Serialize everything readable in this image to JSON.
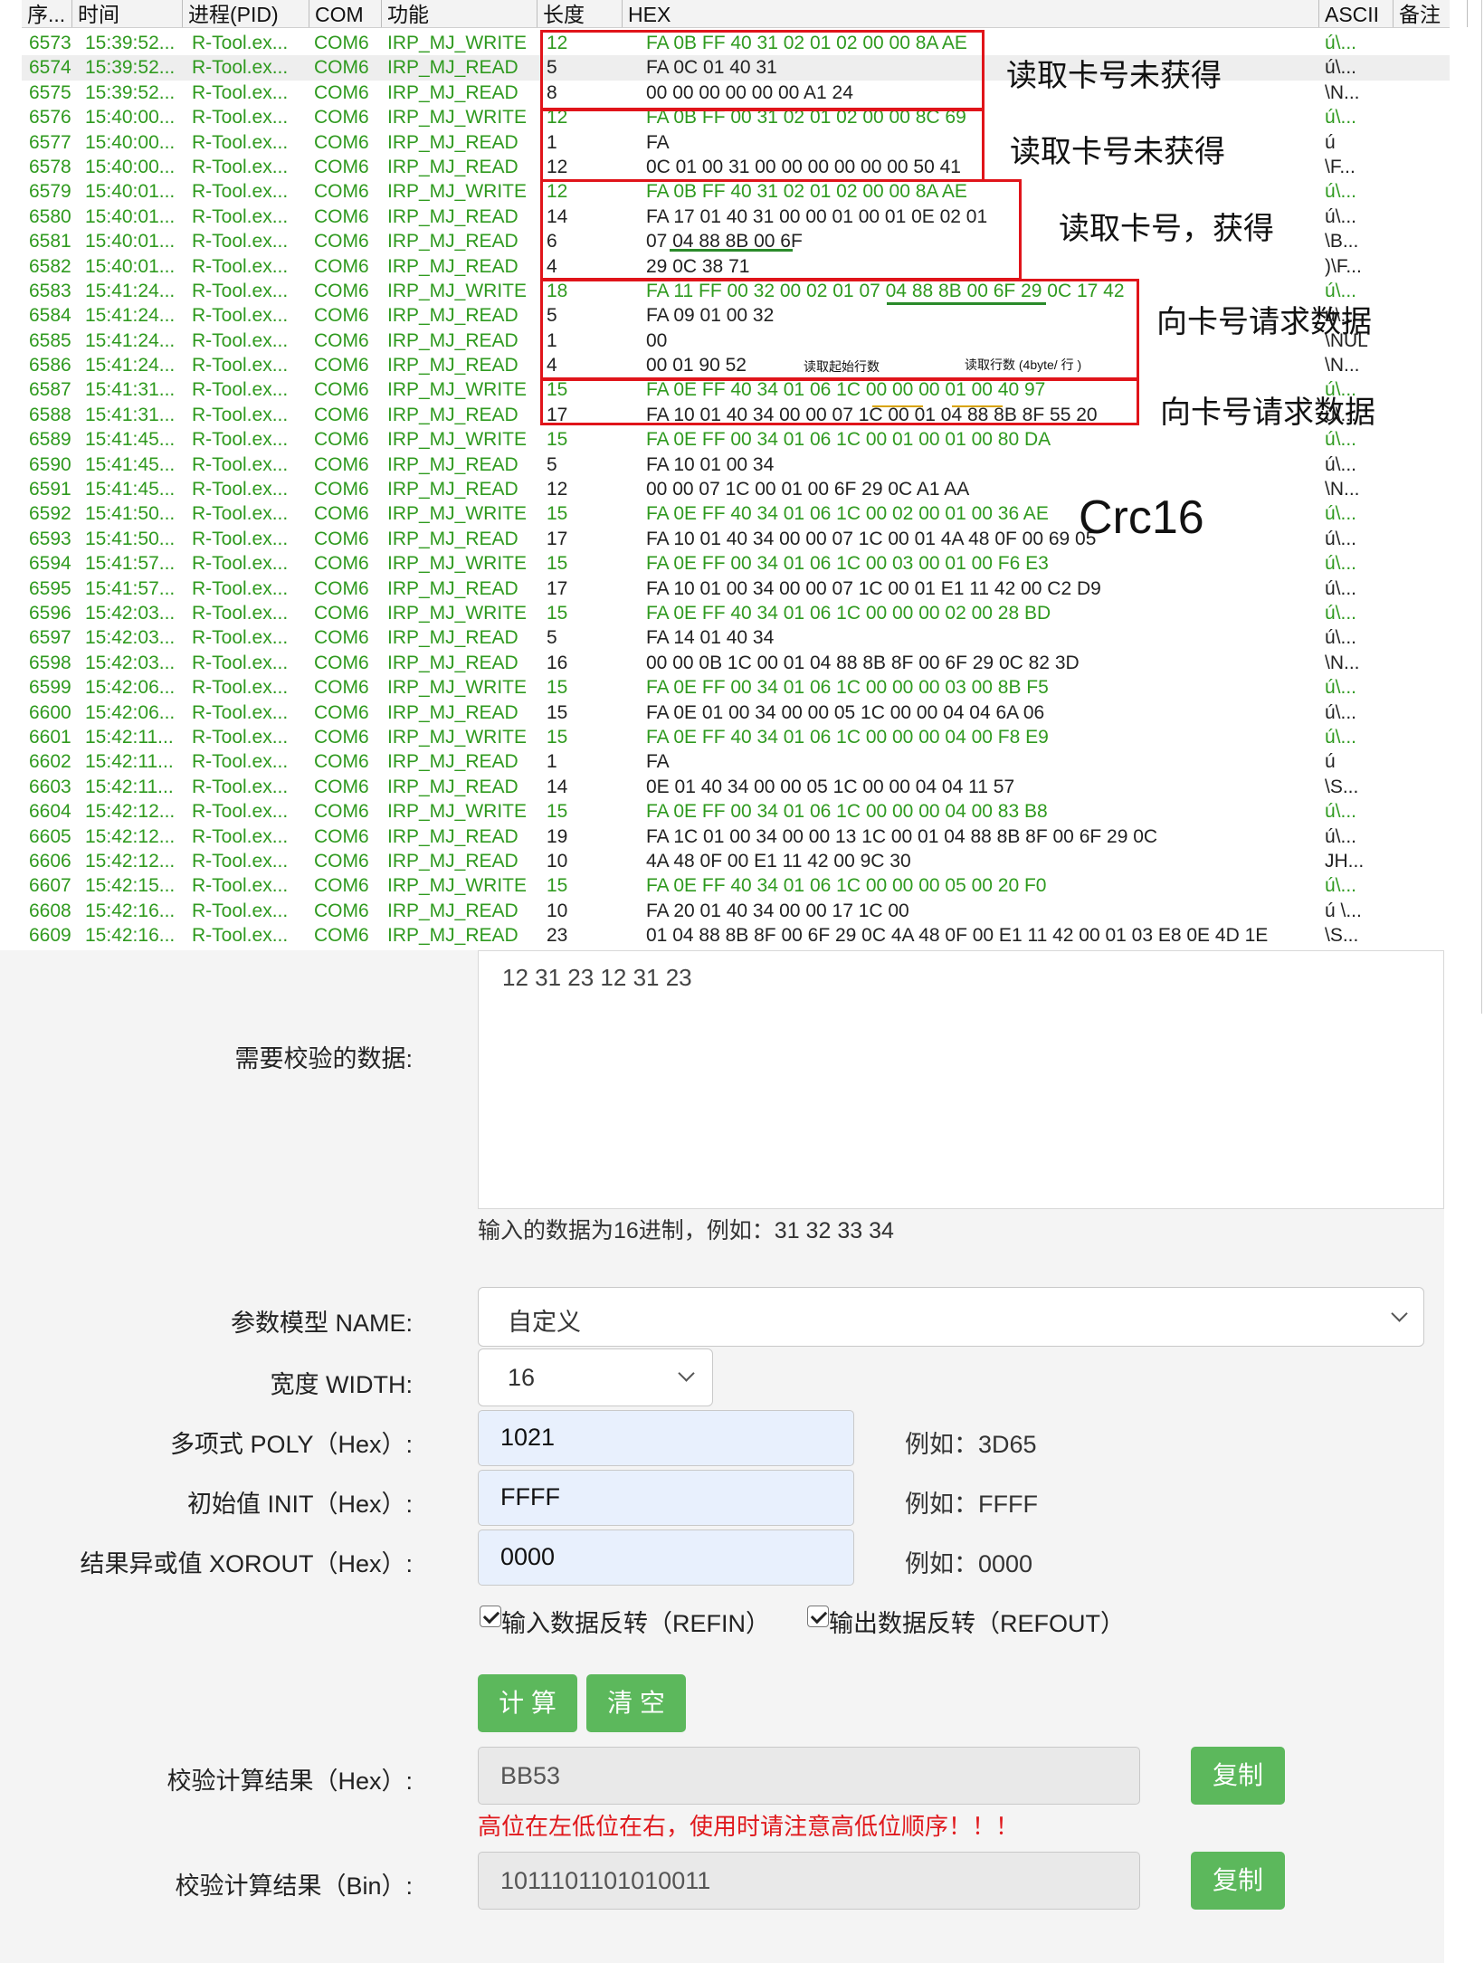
{
  "log": {
    "columns": [
      "序...",
      "时间",
      "进程(PID)",
      "COM",
      "功能",
      "长度",
      "HEX",
      "ASCII",
      "备注"
    ],
    "rows": [
      {
        "seq": "6573",
        "time": "15:39:52...",
        "proc": "R-Tool.ex...",
        "com": "COM6",
        "fn": "IRP_MJ_WRITE",
        "len": "12",
        "hex": "FA 0B FF 40 31 02 01 02 00 00 8A AE",
        "ascii": "ú\\..."
      },
      {
        "seq": "6574",
        "time": "15:39:52...",
        "proc": "R-Tool.ex...",
        "com": "COM6",
        "fn": "IRP_MJ_READ",
        "len": "5",
        "hex": "FA 0C 01 40 31",
        "ascii": "ú\\..."
      },
      {
        "seq": "6575",
        "time": "15:39:52...",
        "proc": "R-Tool.ex...",
        "com": "COM6",
        "fn": "IRP_MJ_READ",
        "len": "8",
        "hex": "00 00 00 00 00 00 A1 24",
        "ascii": "\\N..."
      },
      {
        "seq": "6576",
        "time": "15:40:00...",
        "proc": "R-Tool.ex...",
        "com": "COM6",
        "fn": "IRP_MJ_WRITE",
        "len": "12",
        "hex": "FA 0B FF 00 31 02 01 02 00 00 8C 69",
        "ascii": "ú\\..."
      },
      {
        "seq": "6577",
        "time": "15:40:00...",
        "proc": "R-Tool.ex...",
        "com": "COM6",
        "fn": "IRP_MJ_READ",
        "len": "1",
        "hex": "FA",
        "ascii": "ú"
      },
      {
        "seq": "6578",
        "time": "15:40:00...",
        "proc": "R-Tool.ex...",
        "com": "COM6",
        "fn": "IRP_MJ_READ",
        "len": "12",
        "hex": "0C 01 00 31 00 00 00 00 00 00 50 41",
        "ascii": "\\F..."
      },
      {
        "seq": "6579",
        "time": "15:40:01...",
        "proc": "R-Tool.ex...",
        "com": "COM6",
        "fn": "IRP_MJ_WRITE",
        "len": "12",
        "hex": "FA 0B FF 40 31 02 01 02 00 00 8A AE",
        "ascii": "ú\\..."
      },
      {
        "seq": "6580",
        "time": "15:40:01...",
        "proc": "R-Tool.ex...",
        "com": "COM6",
        "fn": "IRP_MJ_READ",
        "len": "14",
        "hex": "FA 17 01 40 31 00 00 01 00 01 0E 02 01",
        "ascii": "ú\\..."
      },
      {
        "seq": "6581",
        "time": "15:40:01...",
        "proc": "R-Tool.ex...",
        "com": "COM6",
        "fn": "IRP_MJ_READ",
        "len": "6",
        "hex": "07 04 88 8B 00 6F",
        "ascii": "\\B..."
      },
      {
        "seq": "6582",
        "time": "15:40:01...",
        "proc": "R-Tool.ex...",
        "com": "COM6",
        "fn": "IRP_MJ_READ",
        "len": "4",
        "hex": "29 0C 38 71",
        "ascii": ")\\F..."
      },
      {
        "seq": "6583",
        "time": "15:41:24...",
        "proc": "R-Tool.ex...",
        "com": "COM6",
        "fn": "IRP_MJ_WRITE",
        "len": "18",
        "hex": "FA 11 FF 00 32 00 02 01 07 04 88 8B 00 6F 29 0C 17 42",
        "ascii": "ú\\..."
      },
      {
        "seq": "6584",
        "time": "15:41:24...",
        "proc": "R-Tool.ex...",
        "com": "COM6",
        "fn": "IRP_MJ_READ",
        "len": "5",
        "hex": "FA 09 01 00 32",
        "ascii": "ú\\..."
      },
      {
        "seq": "6585",
        "time": "15:41:24...",
        "proc": "R-Tool.ex...",
        "com": "COM6",
        "fn": "IRP_MJ_READ",
        "len": "1",
        "hex": "00",
        "ascii": "\\NUL"
      },
      {
        "seq": "6586",
        "time": "15:41:24...",
        "proc": "R-Tool.ex...",
        "com": "COM6",
        "fn": "IRP_MJ_READ",
        "len": "4",
        "hex": "00 01 90 52",
        "ascii": "\\N..."
      },
      {
        "seq": "6587",
        "time": "15:41:31...",
        "proc": "R-Tool.ex...",
        "com": "COM6",
        "fn": "IRP_MJ_WRITE",
        "len": "15",
        "hex": "FA 0E FF 40 34 01 06 1C 00 00 00 01 00 40 97",
        "ascii": "ú\\..."
      },
      {
        "seq": "6588",
        "time": "15:41:31...",
        "proc": "R-Tool.ex...",
        "com": "COM6",
        "fn": "IRP_MJ_READ",
        "len": "17",
        "hex": "FA 10 01 40 34 00 00 07 1C 00 01 04 88 8B 8F 55 20",
        "ascii": "ú\\..."
      },
      {
        "seq": "6589",
        "time": "15:41:45...",
        "proc": "R-Tool.ex...",
        "com": "COM6",
        "fn": "IRP_MJ_WRITE",
        "len": "15",
        "hex": "FA 0E FF 00 34 01 06 1C 00 01 00 01 00 80 DA",
        "ascii": "ú\\..."
      },
      {
        "seq": "6590",
        "time": "15:41:45...",
        "proc": "R-Tool.ex...",
        "com": "COM6",
        "fn": "IRP_MJ_READ",
        "len": "5",
        "hex": "FA 10 01 00 34",
        "ascii": "ú\\..."
      },
      {
        "seq": "6591",
        "time": "15:41:45...",
        "proc": "R-Tool.ex...",
        "com": "COM6",
        "fn": "IRP_MJ_READ",
        "len": "12",
        "hex": "00 00 07 1C 00 01 00 6F 29 0C A1 AA",
        "ascii": "\\N..."
      },
      {
        "seq": "6592",
        "time": "15:41:50...",
        "proc": "R-Tool.ex...",
        "com": "COM6",
        "fn": "IRP_MJ_WRITE",
        "len": "15",
        "hex": "FA 0E FF 40 34 01 06 1C 00 02 00 01 00 36 AE",
        "ascii": "ú\\..."
      },
      {
        "seq": "6593",
        "time": "15:41:50...",
        "proc": "R-Tool.ex...",
        "com": "COM6",
        "fn": "IRP_MJ_READ",
        "len": "17",
        "hex": "FA 10 01 40 34 00 00 07 1C 00 01 4A 48 0F 00 69 05",
        "ascii": "ú\\..."
      },
      {
        "seq": "6594",
        "time": "15:41:57...",
        "proc": "R-Tool.ex...",
        "com": "COM6",
        "fn": "IRP_MJ_WRITE",
        "len": "15",
        "hex": "FA 0E FF 00 34 01 06 1C 00 03 00 01 00 F6 E3",
        "ascii": "ú\\..."
      },
      {
        "seq": "6595",
        "time": "15:41:57...",
        "proc": "R-Tool.ex...",
        "com": "COM6",
        "fn": "IRP_MJ_READ",
        "len": "17",
        "hex": "FA 10 01 00 34 00 00 07 1C 00 01 E1 11 42 00 C2 D9",
        "ascii": "ú\\..."
      },
      {
        "seq": "6596",
        "time": "15:42:03...",
        "proc": "R-Tool.ex...",
        "com": "COM6",
        "fn": "IRP_MJ_WRITE",
        "len": "15",
        "hex": "FA 0E FF 40 34 01 06 1C 00 00 00 02 00 28 BD",
        "ascii": "ú\\..."
      },
      {
        "seq": "6597",
        "time": "15:42:03...",
        "proc": "R-Tool.ex...",
        "com": "COM6",
        "fn": "IRP_MJ_READ",
        "len": "5",
        "hex": "FA 14 01 40 34",
        "ascii": "ú\\..."
      },
      {
        "seq": "6598",
        "time": "15:42:03...",
        "proc": "R-Tool.ex...",
        "com": "COM6",
        "fn": "IRP_MJ_READ",
        "len": "16",
        "hex": "00 00 0B 1C 00 01 04 88 8B 8F 00 6F 29 0C 82 3D",
        "ascii": "\\N..."
      },
      {
        "seq": "6599",
        "time": "15:42:06...",
        "proc": "R-Tool.ex...",
        "com": "COM6",
        "fn": "IRP_MJ_WRITE",
        "len": "15",
        "hex": "FA 0E FF 00 34 01 06 1C 00 00 00 03 00 8B F5",
        "ascii": "ú\\..."
      },
      {
        "seq": "6600",
        "time": "15:42:06...",
        "proc": "R-Tool.ex...",
        "com": "COM6",
        "fn": "IRP_MJ_READ",
        "len": "15",
        "hex": "FA 0E 01 00 34 00 00 05 1C 00 00 04 04 6A 06",
        "ascii": "ú\\..."
      },
      {
        "seq": "6601",
        "time": "15:42:11...",
        "proc": "R-Tool.ex...",
        "com": "COM6",
        "fn": "IRP_MJ_WRITE",
        "len": "15",
        "hex": "FA 0E FF 40 34 01 06 1C 00 00 00 04 00 F8 E9",
        "ascii": "ú\\..."
      },
      {
        "seq": "6602",
        "time": "15:42:11...",
        "proc": "R-Tool.ex...",
        "com": "COM6",
        "fn": "IRP_MJ_READ",
        "len": "1",
        "hex": "FA",
        "ascii": "ú"
      },
      {
        "seq": "6603",
        "time": "15:42:11...",
        "proc": "R-Tool.ex...",
        "com": "COM6",
        "fn": "IRP_MJ_READ",
        "len": "14",
        "hex": "0E 01 40 34 00 00 05 1C 00 00 04 04 11 57",
        "ascii": "\\S..."
      },
      {
        "seq": "6604",
        "time": "15:42:12...",
        "proc": "R-Tool.ex...",
        "com": "COM6",
        "fn": "IRP_MJ_WRITE",
        "len": "15",
        "hex": "FA 0E FF 00 34 01 06 1C 00 00 00 04 00 83 B8",
        "ascii": "ú\\..."
      },
      {
        "seq": "6605",
        "time": "15:42:12...",
        "proc": "R-Tool.ex...",
        "com": "COM6",
        "fn": "IRP_MJ_READ",
        "len": "19",
        "hex": "FA 1C 01 00 34 00 00 13 1C 00 01 04 88 8B 8F 00 6F 29 0C",
        "ascii": "ú\\..."
      },
      {
        "seq": "6606",
        "time": "15:42:12...",
        "proc": "R-Tool.ex...",
        "com": "COM6",
        "fn": "IRP_MJ_READ",
        "len": "10",
        "hex": "4A 48 0F 00 E1 11 42 00 9C 30",
        "ascii": "JH..."
      },
      {
        "seq": "6607",
        "time": "15:42:15...",
        "proc": "R-Tool.ex...",
        "com": "COM6",
        "fn": "IRP_MJ_WRITE",
        "len": "15",
        "hex": "FA 0E FF 40 34 01 06 1C 00 00 00 05 00 20 F0",
        "ascii": "ú\\..."
      },
      {
        "seq": "6608",
        "time": "15:42:16...",
        "proc": "R-Tool.ex...",
        "com": "COM6",
        "fn": "IRP_MJ_READ",
        "len": "10",
        "hex": "FA 20 01 40 34 00 00 17 1C 00",
        "ascii": "ú \\..."
      },
      {
        "seq": "6609",
        "time": "15:42:16...",
        "proc": "R-Tool.ex...",
        "com": "COM6",
        "fn": "IRP_MJ_READ",
        "len": "23",
        "hex": "01 04 88 8B 8F 00 6F 29 0C 4A 48 0F 00 E1 11 42 00 01 03 E8 0E 4D 1E",
        "ascii": "\\S..."
      }
    ],
    "annotations": {
      "a1": "读取卡号未获得",
      "a2": "读取卡号未获得",
      "a3": "读取卡号，获得",
      "a4": "向卡号请求数据",
      "a5": "向卡号请求数据",
      "crc": "Crc16",
      "small1": "读取起始行数",
      "small2": "读取行数 (4byte/ 行 )"
    }
  },
  "form": {
    "data_label": "需要校验的数据:",
    "data_value": "12 31 23 12 31 23",
    "data_hint": "输入的数据为16进制，例如：31 32 33 34",
    "name_label": "参数模型 NAME:",
    "name_value": "自定义",
    "width_label": "宽度 WIDTH:",
    "width_value": "16",
    "poly_label": "多项式 POLY（Hex）:",
    "poly_value": "1021",
    "poly_example": "例如：3D65",
    "init_label": "初始值 INIT（Hex）:",
    "init_value": "FFFF",
    "init_example": "例如：FFFF",
    "xorout_label": "结果异或值 XOROUT（Hex）:",
    "xorout_value": "0000",
    "xorout_example": "例如：0000",
    "refin_label": "输入数据反转（REFIN）",
    "refout_label": "输出数据反转（REFOUT）",
    "calc_button": "计 算",
    "clear_button": "清 空",
    "hex_result_label": "校验计算结果（Hex）:",
    "hex_result_value": "BB53",
    "copy_button": "复制",
    "warning": "高位在左低位在右，使用时请注意高低位顺序！！！",
    "bin_result_label": "校验计算结果（Bin）:",
    "bin_result_value": "1011101101010011",
    "copy_button2": "复制"
  },
  "colors": {
    "green_text": "#2f9a1f",
    "red_box": "#e0141a",
    "button_green": "#5cb85c",
    "warning_red": "#e0191d"
  }
}
